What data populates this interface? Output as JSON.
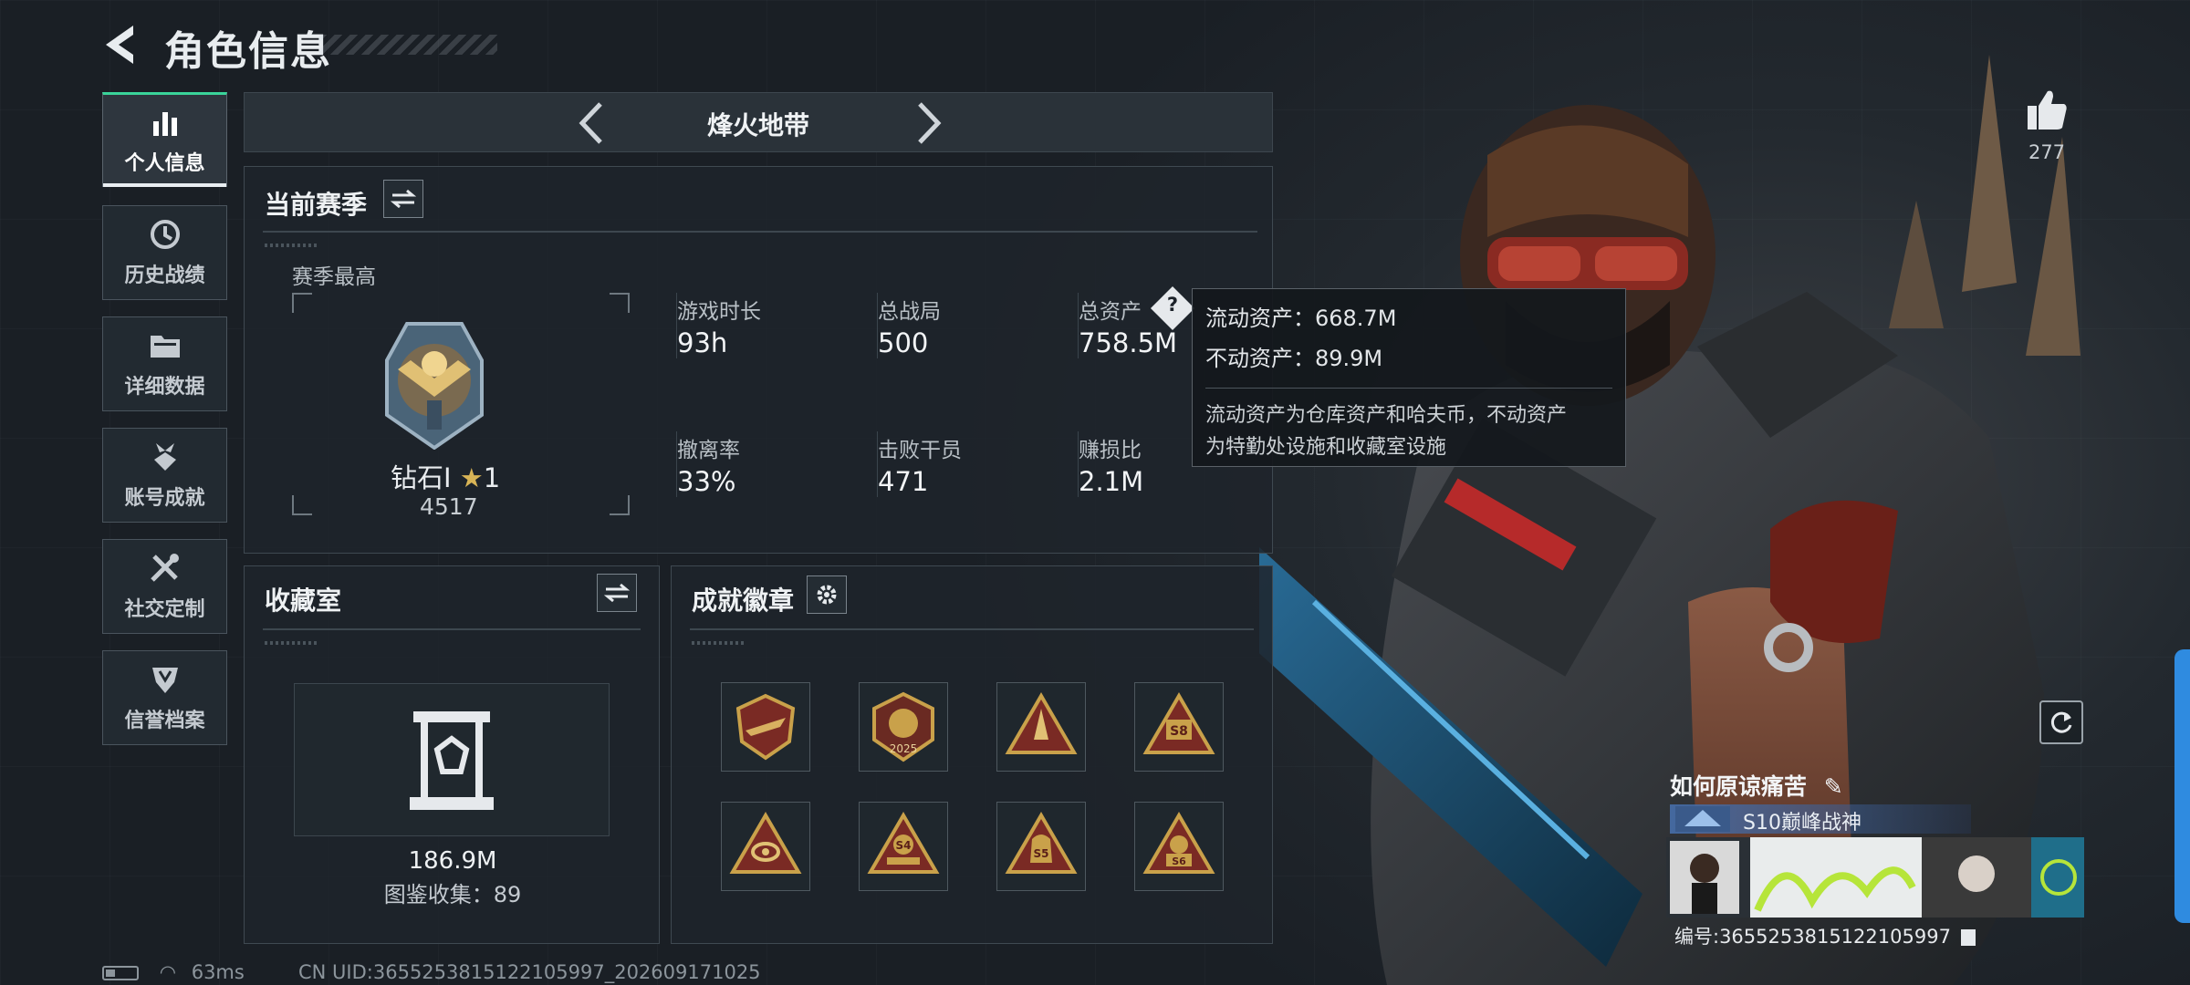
{
  "header": {
    "title": "角色信息"
  },
  "nav": {
    "items": [
      {
        "label": "个人信息",
        "icon": "bar-chart-icon",
        "active": true
      },
      {
        "label": "历史战绩",
        "icon": "history-clock-icon"
      },
      {
        "label": "详细数据",
        "icon": "folder-icon"
      },
      {
        "label": "账号成就",
        "icon": "medal-icon"
      },
      {
        "label": "社交定制",
        "icon": "tools-icon"
      },
      {
        "label": "信誉档案",
        "icon": "shield-badge-icon"
      }
    ]
  },
  "mode": {
    "title": "烽火地带"
  },
  "season": {
    "title": "当前赛季",
    "best_label": "赛季最高",
    "rank_name": "钻石Ⅰ",
    "rank_star": "1",
    "rank_score": "4517",
    "stats": {
      "playtime": {
        "label": "游戏时长",
        "value": "93h"
      },
      "matches": {
        "label": "总战局",
        "value": "500"
      },
      "assets": {
        "label": "总资产",
        "value": "758.5M",
        "help": "?"
      },
      "extract_rate": {
        "label": "撤离率",
        "value": "33%"
      },
      "kills": {
        "label": "击败干员",
        "value": "471"
      },
      "profit_ratio": {
        "label": "赚损比",
        "value": "2.1M"
      }
    }
  },
  "tooltip": {
    "liquid": "流动资产：668.7M",
    "fixed": "不动资产：89.9M",
    "desc_line1": "流动资产为仓库资产和哈夫币，不动资产",
    "desc_line2": "为特勤处设施和收藏室设施"
  },
  "collection": {
    "title": "收藏室",
    "value": "186.9M",
    "catalog": "图鉴收集：89"
  },
  "achievements": {
    "title": "成就徽章",
    "badges": [
      {
        "icon": "badge-plane-icon",
        "text": ""
      },
      {
        "icon": "badge-2025-icon",
        "text": "2025"
      },
      {
        "icon": "badge-rocket-icon",
        "text": ""
      },
      {
        "icon": "badge-s8-icon",
        "text": "S8"
      },
      {
        "icon": "badge-eye-icon",
        "text": ""
      },
      {
        "icon": "badge-s4-icon",
        "text": "S4"
      },
      {
        "icon": "badge-s5-icon",
        "text": "S5"
      },
      {
        "icon": "badge-s6-icon",
        "text": "S6"
      }
    ]
  },
  "footer": {
    "ping": "63ms",
    "uid": "CN UID:3655253815122105997_202609171025"
  },
  "profile": {
    "likes": "277",
    "name": "如何原谅痛苦",
    "rank_title": "S10巅峰战神",
    "id": "编号:3655253815122105997"
  },
  "colors": {
    "accent": "#3ad49a",
    "gold": "#c9a14a",
    "badge_red": "#7a2a24",
    "edge_tab": "#2f8be0"
  }
}
